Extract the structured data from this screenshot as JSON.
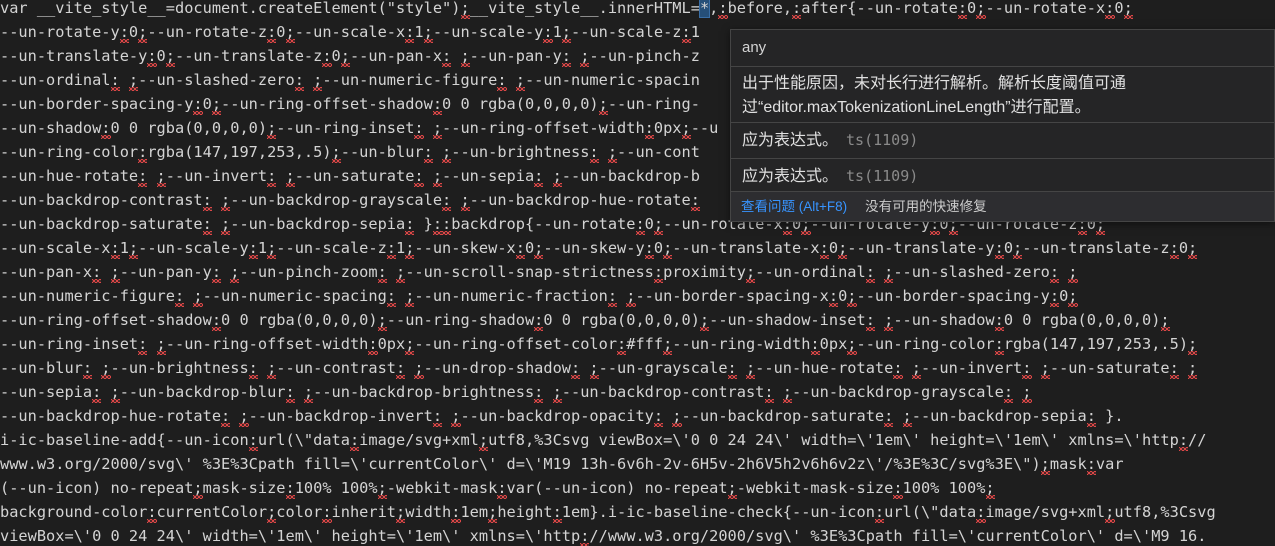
{
  "editor": {
    "lines": [
      {
        "text": "var __vite_style__=document.createElement(\"style\");__vite_style__.innerHTML=*,:before,:after{--un-rotate:0;--un-rotate-x:0;"
      },
      {
        "text": "--un-rotate-y:0;--un-rotate-z:0;--un-scale-x:1;--un-scale-y:1;--un-scale-z:1"
      },
      {
        "text": "--un-translate-y:0;--un-translate-z:0;--un-pan-x: ;--un-pan-y: ;--un-pinch-z"
      },
      {
        "text": "--un-ordinal: ;--un-slashed-zero: ;--un-numeric-figure: ;--un-numeric-spacin"
      },
      {
        "text": "--un-border-spacing-y:0;--un-ring-offset-shadow:0 0 rgba(0,0,0,0);--un-ring-"
      },
      {
        "text": "--un-shadow:0 0 rgba(0,0,0,0);--un-ring-inset: ;--un-ring-offset-width:0px;--u"
      },
      {
        "text": "--un-ring-color:rgba(147,197,253,.5);--un-blur: ;--un-brightness: ;--un-cont"
      },
      {
        "text": "--un-hue-rotate: ;--un-invert: ;--un-saturate: ;--un-sepia: ;--un-backdrop-b"
      },
      {
        "text": "--un-backdrop-contrast: ;--un-backdrop-grayscale: ;--un-backdrop-hue-rotate:"
      },
      {
        "text": "--un-backdrop-saturate: ;--un-backdrop-sepia: }::backdrop{--un-rotate:0;--un-rotate-x:0;--un-rotate-y:0;--un-rotate-z:0;"
      },
      {
        "text": "--un-scale-x:1;--un-scale-y:1;--un-scale-z:1;--un-skew-x:0;--un-skew-y:0;--un-translate-x:0;--un-translate-y:0;--un-translate-z:0;"
      },
      {
        "text": "--un-pan-x: ;--un-pan-y: ;--un-pinch-zoom: ;--un-scroll-snap-strictness:proximity;--un-ordinal: ;--un-slashed-zero: ;"
      },
      {
        "text": "--un-numeric-figure: ;--un-numeric-spacing: ;--un-numeric-fraction: ;--un-border-spacing-x:0;--un-border-spacing-y:0;"
      },
      {
        "text": "--un-ring-offset-shadow:0 0 rgba(0,0,0,0);--un-ring-shadow:0 0 rgba(0,0,0,0);--un-shadow-inset: ;--un-shadow:0 0 rgba(0,0,0,0);"
      },
      {
        "text": "--un-ring-inset: ;--un-ring-offset-width:0px;--un-ring-offset-color:#fff;--un-ring-width:0px;--un-ring-color:rgba(147,197,253,.5);"
      },
      {
        "text": "--un-blur: ;--un-brightness: ;--un-contrast: ;--un-drop-shadow: ;--un-grayscale: ;--un-hue-rotate: ;--un-invert: ;--un-saturate: ;"
      },
      {
        "text": "--un-sepia: ;--un-backdrop-blur: ;--un-backdrop-brightness: ;--un-backdrop-contrast: ;--un-backdrop-grayscale: ;"
      },
      {
        "text": "--un-backdrop-hue-rotate: ;--un-backdrop-invert: ;--un-backdrop-opacity: ;--un-backdrop-saturate: ;--un-backdrop-sepia: }."
      },
      {
        "text": "i-ic-baseline-add{--un-icon:url(\\\"data:image/svg+xml;utf8,%3Csvg viewBox=\\'0 0 24 24\\' width=\\'1em\\' height=\\'1em\\' xmlns=\\'http://"
      },
      {
        "text": "www.w3.org/2000/svg\\' %3E%3Cpath fill=\\'currentColor\\' d=\\'M19 13h-6v6h-2v-6H5v-2h6V5h2v6h6v2z\\'/%3E%3C/svg%3E\\\");mask:var"
      },
      {
        "text": "(--un-icon) no-repeat;mask-size:100% 100%;-webkit-mask:var(--un-icon) no-repeat;-webkit-mask-size:100% 100%;"
      },
      {
        "text": "background-color:currentColor;color:inherit;width:1em;height:1em}.i-ic-baseline-check{--un-icon:url(\\\"data:image/svg+xml;utf8,%3Csvg"
      },
      {
        "text": "viewBox=\\'0 0 24 24\\' width=\\'1em\\' height=\\'1em\\' xmlns=\\'http://www.w3.org/2000/svg\\' %3E%3Cpath fill=\\'currentColor\\' d=\\'M9 16."
      }
    ]
  },
  "hover": {
    "type_text": "any",
    "message": "出于性能原因，未对长行进行解析。解析长度阈值可通过“editor.maxTokenizationLineLength”进行配置。",
    "diagnostics": [
      {
        "text": "应为表达式。",
        "code": "ts(1109)"
      },
      {
        "text": "应为表达式。",
        "code": "ts(1109)"
      }
    ],
    "view_problem_label": "查看问题 (Alt+F8)",
    "no_quick_fix_label": "没有可用的快速修复"
  },
  "colors": {
    "background": "#1e1e1e",
    "text": "#d4d4d4",
    "error_squiggle": "#f14c4c",
    "link": "#3794ff"
  }
}
